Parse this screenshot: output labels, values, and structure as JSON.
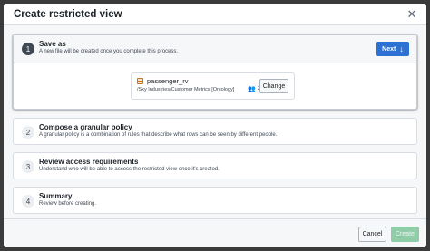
{
  "dialog": {
    "title": "Create restricted view",
    "close_icon": "close-icon"
  },
  "steps": [
    {
      "number": "1",
      "title": "Save as",
      "description": "A new file will be created once you complete this process.",
      "active": true,
      "next_label": "Next",
      "next_icon": "arrow-down-icon",
      "file": {
        "icon": "table-icon",
        "name": "passenger_rv",
        "path": "/Sky Industries/Customer Metrics [Ontology]",
        "share_icon": "people-icon",
        "share_count": "2"
      },
      "change_label": "Change"
    },
    {
      "number": "2",
      "title": "Compose a granular policy",
      "description": "A granular policy is a combination of rules that describe what rows can be seen by different people.",
      "active": false
    },
    {
      "number": "3",
      "title": "Review access requirements",
      "description": "Understand who will be able to access the restricted view once it's created.",
      "active": false
    },
    {
      "number": "4",
      "title": "Summary",
      "description": "Review before creating.",
      "active": false
    }
  ],
  "footer": {
    "cancel_label": "Cancel",
    "create_label": "Create"
  },
  "colors": {
    "primary": "#2d72d2",
    "create_disabled": "#8fcca8",
    "file_icon": "#c87619"
  }
}
